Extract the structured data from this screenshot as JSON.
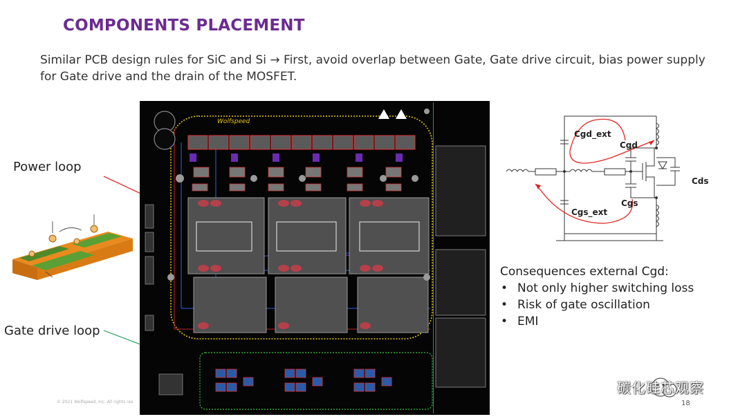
{
  "slide": {
    "title": "COMPONENTS PLACEMENT",
    "subtitle": "Similar PCB design rules for SiC and Si → First, avoid overlap between Gate, Gate drive circuit, bias power supply for Gate drive and the drain of the MOSFET.",
    "page_number": "18",
    "copyright": "© 2021 Wolfspeed, Inc. All rights res"
  },
  "labels": {
    "power_loop": "Power loop",
    "gate_drive_loop": "Gate drive loop"
  },
  "pcb": {
    "brand": "Wolfspeed"
  },
  "circuit": {
    "cgd_ext": "Cgd_ext",
    "cgd": "Cgd",
    "cds": "Cds",
    "cgs": "Cgs",
    "cgs_ext": "Cgs_ext"
  },
  "consequences": {
    "heading": "Consequences external Cgd:",
    "items": [
      "Not only higher switching loss",
      "Risk of gate oscillation",
      "EMI"
    ]
  },
  "watermark": {
    "text": "碳化硅芯观察"
  },
  "colors": {
    "title": "#6b2c91",
    "power_arrow": "#e0312e",
    "gate_arrow": "#1aa05a",
    "annotation": "#e52421",
    "pcb_bg": "#050505"
  }
}
